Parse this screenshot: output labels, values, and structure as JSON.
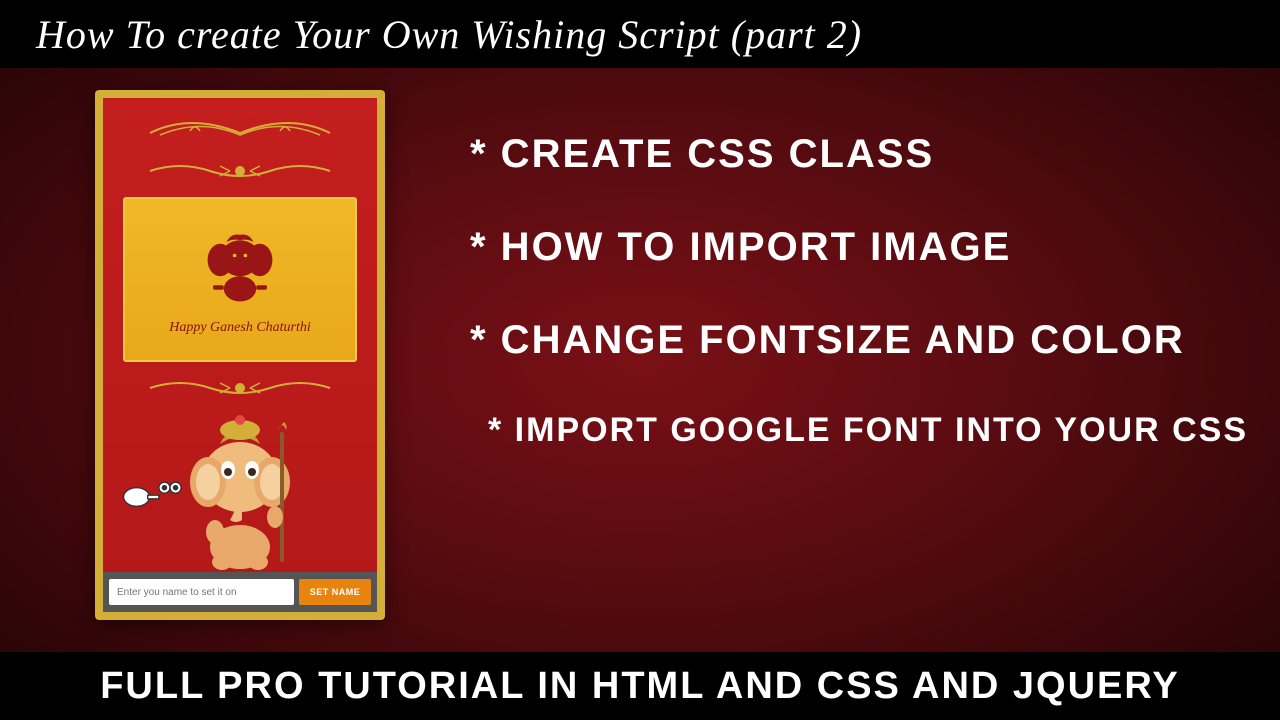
{
  "header": {
    "title": "How To create Your Own Wishing Script  (part 2)"
  },
  "footer": {
    "text": "FULL PRO TUTORIAL IN HTML AND CSS AND JQUERY"
  },
  "bullets": [
    "* CREATE CSS CLASS",
    "* HOW TO IMPORT IMAGE",
    "* CHANGE FONTSIZE AND COLOR",
    "* IMPORT GOOGLE FONT INTO YOUR CSS"
  ],
  "phone": {
    "card_text": "Happy Ganesh Chaturthi",
    "input_placeholder": "Enter you name to set it on",
    "button_label": "SET NAME"
  }
}
